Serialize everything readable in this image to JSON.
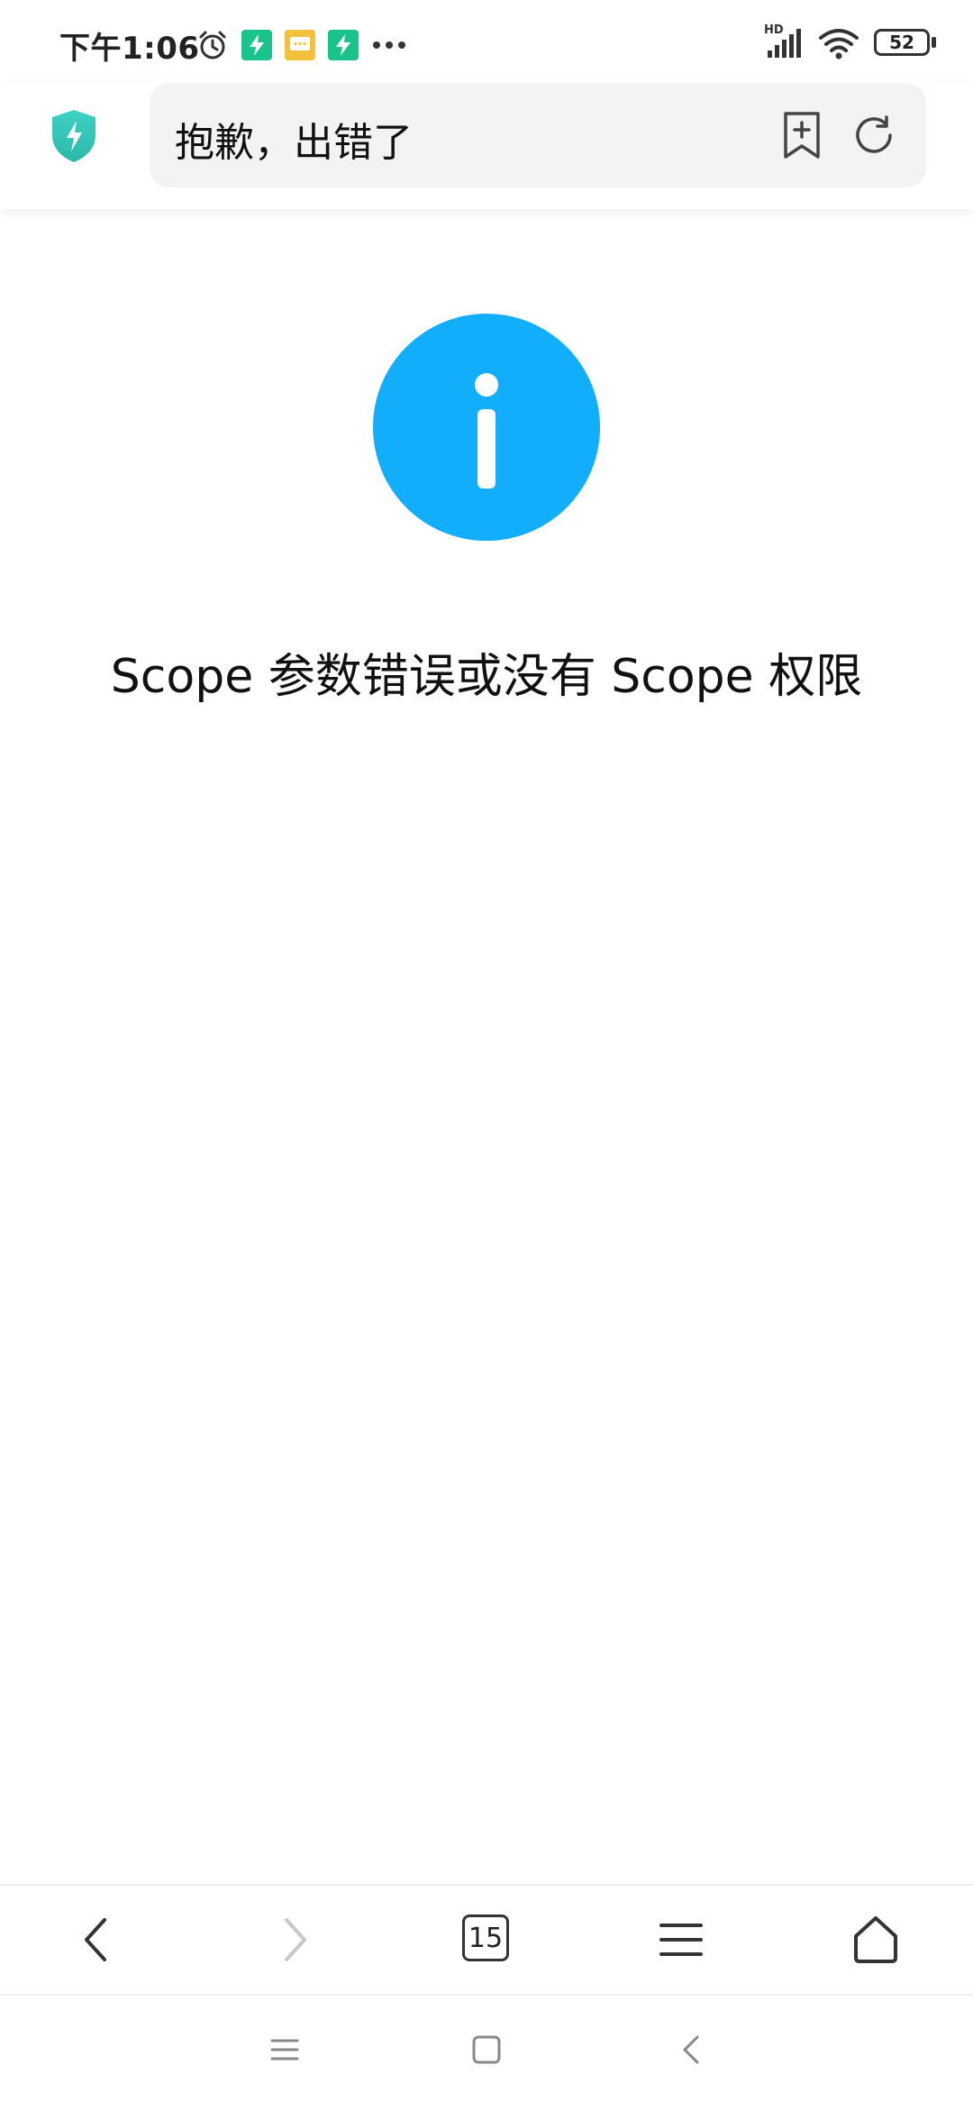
{
  "status_bar": {
    "time": "下午1:06",
    "battery": "52",
    "network_label": "HD"
  },
  "address_bar": {
    "title": "抱歉，出错了"
  },
  "content": {
    "message": "Scope 参数错误或没有 Scope 权限"
  },
  "bottom_nav": {
    "tab_count": "15"
  },
  "colors": {
    "info_blue": "#12aefc",
    "shield_teal": "#3fd1c5",
    "notif_green": "#19c38a",
    "notif_yellow": "#f3c13c"
  },
  "icons": [
    "alarm-icon",
    "lightning-icon",
    "message-icon",
    "signal-icon",
    "wifi-icon",
    "battery-icon",
    "shield-icon",
    "bookmark-add-icon",
    "reload-icon",
    "info-icon",
    "back-icon",
    "forward-icon",
    "tabs-icon",
    "menu-icon",
    "home-icon"
  ]
}
